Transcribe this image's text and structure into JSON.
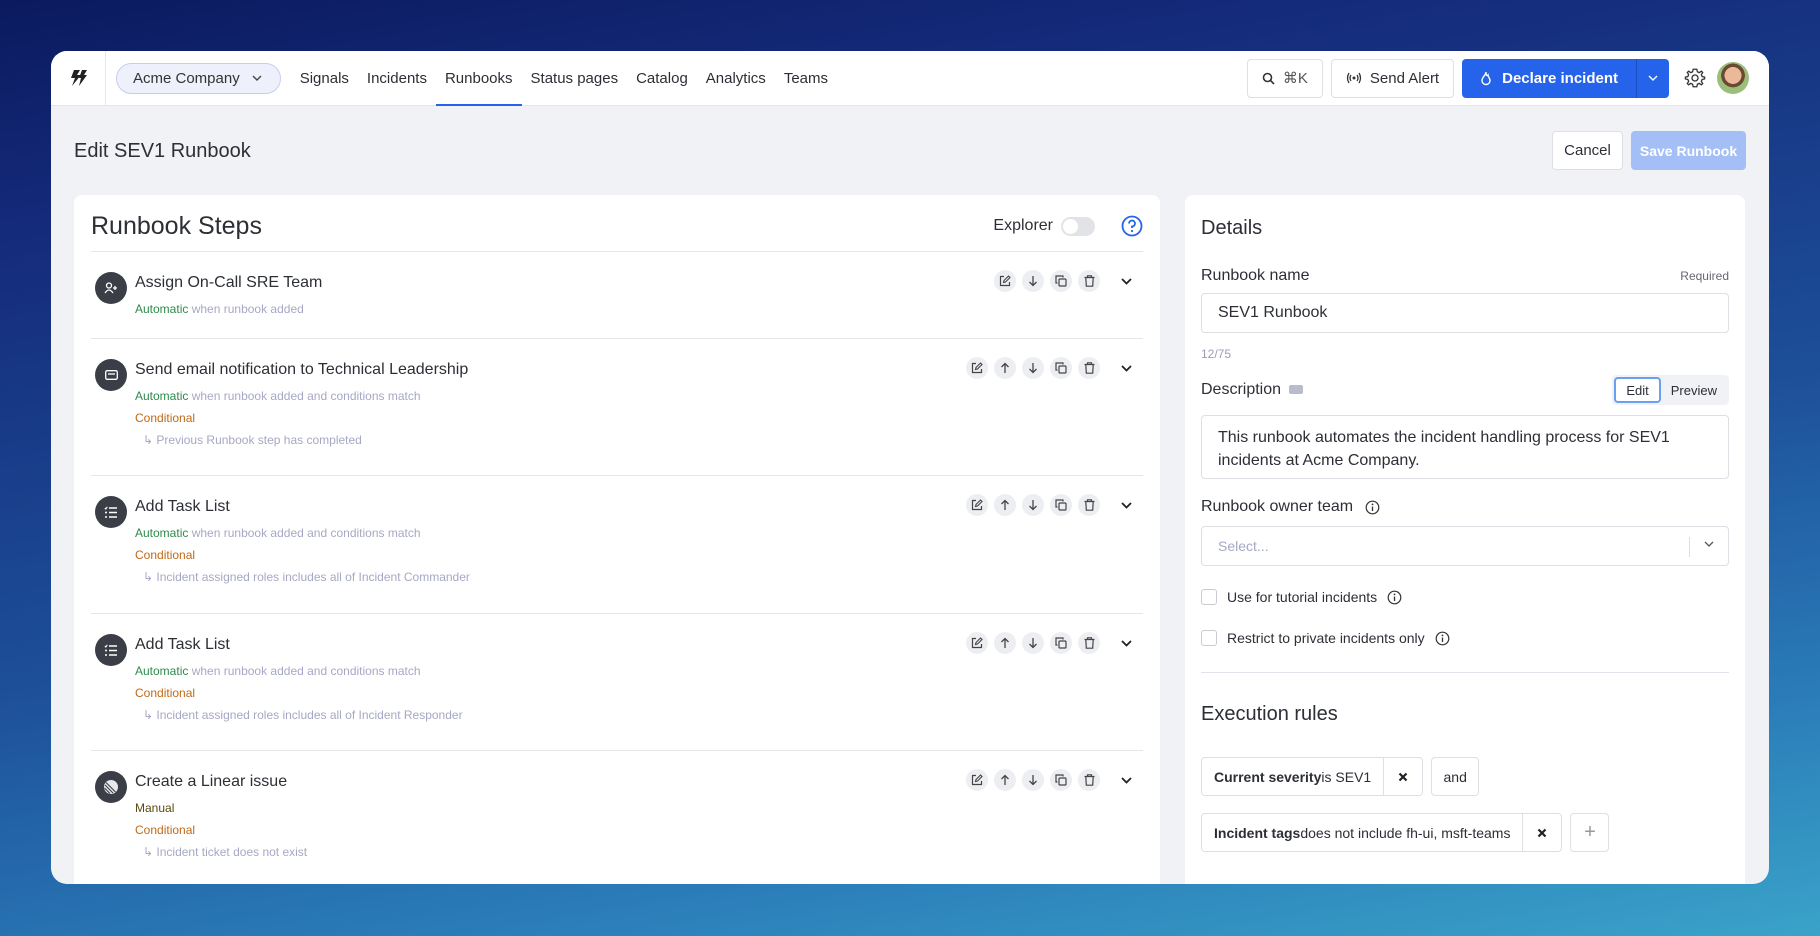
{
  "nav": {
    "org": "Acme Company",
    "links": [
      "Signals",
      "Incidents",
      "Runbooks",
      "Status pages",
      "Catalog",
      "Analytics",
      "Teams"
    ],
    "active_link": "Runbooks",
    "search_shortcut": "⌘K",
    "send_alert": "Send Alert",
    "declare_incident": "Declare incident"
  },
  "page": {
    "title": "Edit SEV1 Runbook",
    "cancel": "Cancel",
    "save": "Save Runbook"
  },
  "steps_panel": {
    "title": "Runbook Steps",
    "explorer_label": "Explorer",
    "explorer_on": false,
    "steps": [
      {
        "icon": "user-plus-icon",
        "title": "Assign On-Call SRE Team",
        "trigger_type": "Automatic",
        "trigger_text": "when runbook added",
        "conditional": null,
        "condition_text": null,
        "actions": [
          "edit",
          "move-down",
          "duplicate",
          "delete"
        ]
      },
      {
        "icon": "mail-icon",
        "title": "Send email notification to Technical Leadership",
        "trigger_type": "Automatic",
        "trigger_text": "when runbook added and conditions match",
        "conditional": "Conditional",
        "condition_text": "↳ Previous Runbook step has completed",
        "actions": [
          "edit",
          "move-up",
          "move-down",
          "duplicate",
          "delete"
        ]
      },
      {
        "icon": "task-list-icon",
        "title": "Add Task List",
        "trigger_type": "Automatic",
        "trigger_text": "when runbook added and conditions match",
        "conditional": "Conditional",
        "condition_text": "↳ Incident assigned roles includes all of Incident Commander",
        "actions": [
          "edit",
          "move-up",
          "move-down",
          "duplicate",
          "delete"
        ]
      },
      {
        "icon": "task-list-icon",
        "title": "Add Task List",
        "trigger_type": "Automatic",
        "trigger_text": "when runbook added and conditions match",
        "conditional": "Conditional",
        "condition_text": "↳ Incident assigned roles includes all of Incident Responder",
        "actions": [
          "edit",
          "move-up",
          "move-down",
          "duplicate",
          "delete"
        ]
      },
      {
        "icon": "linear-icon",
        "title": "Create a Linear issue",
        "trigger_type": "Manual",
        "trigger_text": "",
        "conditional": "Conditional",
        "condition_text": "↳ Incident ticket does not exist",
        "actions": [
          "edit",
          "move-up",
          "move-down",
          "duplicate",
          "delete"
        ]
      }
    ]
  },
  "details": {
    "title": "Details",
    "name_label": "Runbook name",
    "required": "Required",
    "name_value": "SEV1 Runbook",
    "name_counter": "12/75",
    "description_label": "Description",
    "edit_tab": "Edit",
    "preview_tab": "Preview",
    "description_value": "This runbook automates the incident handling process for SEV1 incidents at Acme Company.",
    "owner_label": "Runbook owner team",
    "owner_placeholder": "Select...",
    "tutorial_label": "Use for tutorial incidents",
    "tutorial_checked": false,
    "private_label": "Restrict to private incidents only",
    "private_checked": false,
    "execution_title": "Execution rules",
    "rules": [
      {
        "field": "Current severity",
        "rest": " is SEV1"
      },
      {
        "field": "Incident tags",
        "rest": " does not include fh-ui, msft-teams"
      }
    ],
    "connector": "and",
    "add_rule": "+"
  },
  "colors": {
    "accent": "#2563eb",
    "automatic": "#2f8a4c",
    "conditional": "#c06a17"
  }
}
